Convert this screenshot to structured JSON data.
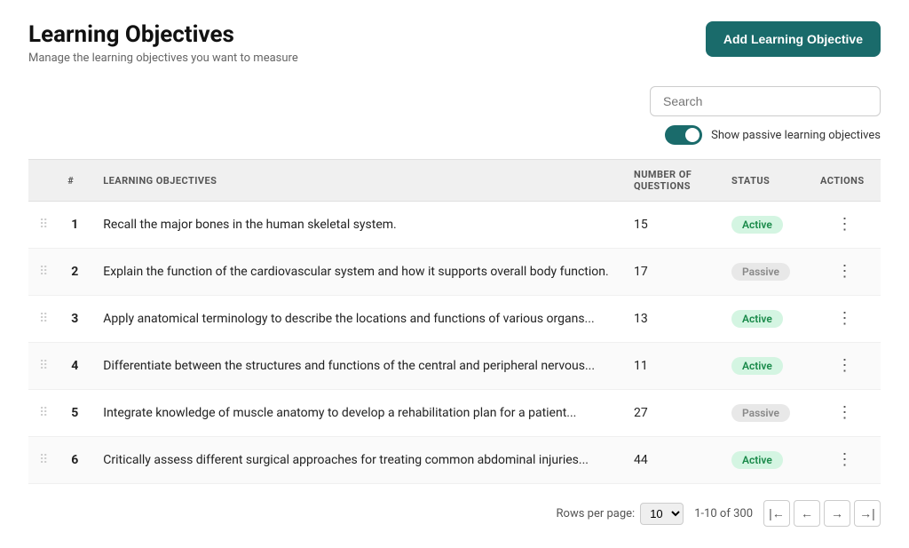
{
  "header": {
    "title": "Learning Objectives",
    "subtitle": "Manage the learning objectives you want to measure",
    "add_button_label": "Add Learning Objective"
  },
  "toolbar": {
    "search_placeholder": "Search",
    "toggle_label": "Show passive learning objectives"
  },
  "table": {
    "columns": [
      {
        "key": "drag",
        "label": ""
      },
      {
        "key": "num",
        "label": "#"
      },
      {
        "key": "objective",
        "label": "Learning Objectives"
      },
      {
        "key": "questions",
        "label": "Number of Questions"
      },
      {
        "key": "status",
        "label": "Status"
      },
      {
        "key": "actions",
        "label": "Actions"
      }
    ],
    "rows": [
      {
        "id": 1,
        "objective": "Recall the major bones in the human skeletal system.",
        "questions": 15,
        "status": "Active"
      },
      {
        "id": 2,
        "objective": "Explain the function of the cardiovascular system and how it supports overall body function.",
        "questions": 17,
        "status": "Passive"
      },
      {
        "id": 3,
        "objective": "Apply anatomical terminology to describe the locations and functions of various organs...",
        "questions": 13,
        "status": "Active"
      },
      {
        "id": 4,
        "objective": "Differentiate between the structures and functions of the central and peripheral nervous...",
        "questions": 11,
        "status": "Active"
      },
      {
        "id": 5,
        "objective": "Integrate knowledge of muscle anatomy to develop a rehabilitation plan for a patient...",
        "questions": 27,
        "status": "Passive"
      },
      {
        "id": 6,
        "objective": "Critically assess different surgical approaches for treating common abdominal injuries...",
        "questions": 44,
        "status": "Active"
      }
    ]
  },
  "pagination": {
    "rows_per_page_label": "Rows per page:",
    "rows_per_page_value": "10",
    "page_info": "1-10 of 300"
  }
}
